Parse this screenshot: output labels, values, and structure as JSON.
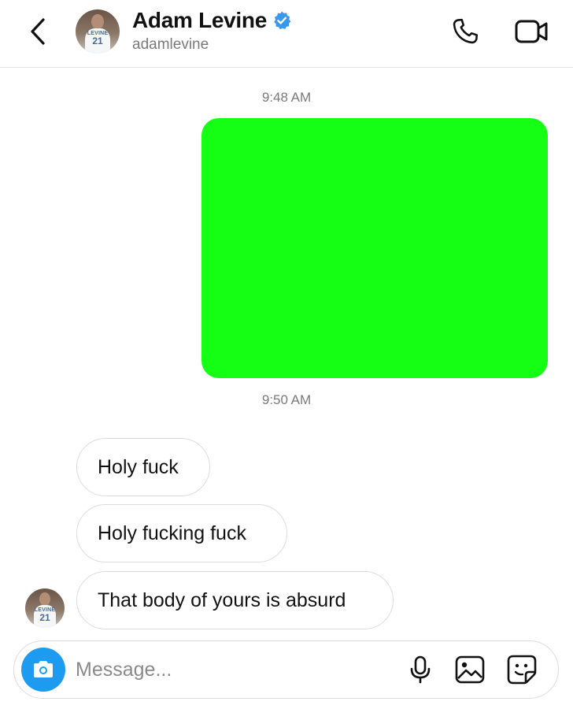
{
  "header": {
    "name": "Adam Levine",
    "username": "adamlevine",
    "verified": true,
    "avatar_jersey_name": "LEVINE",
    "avatar_jersey_number": "21"
  },
  "icons": {
    "back": "chevron-left-icon",
    "call": "phone-icon",
    "video": "video-camera-icon",
    "verified": "verified-badge-icon",
    "camera": "camera-icon",
    "mic": "microphone-icon",
    "gallery": "image-icon",
    "sticker": "sticker-icon"
  },
  "colors": {
    "verified_blue": "#3897f0",
    "camera_blue": "#1c9bf0",
    "media_placeholder": "#14ff14",
    "timestamp_gray": "#7a7a7a"
  },
  "thread": {
    "timestamp_1": "9:48 AM",
    "timestamp_2": "9:50 AM",
    "received_messages": [
      {
        "text": "Holy fuck"
      },
      {
        "text": "Holy fucking fuck"
      },
      {
        "text": "That body of yours is absurd"
      }
    ]
  },
  "composer": {
    "placeholder": "Message...",
    "value": ""
  }
}
